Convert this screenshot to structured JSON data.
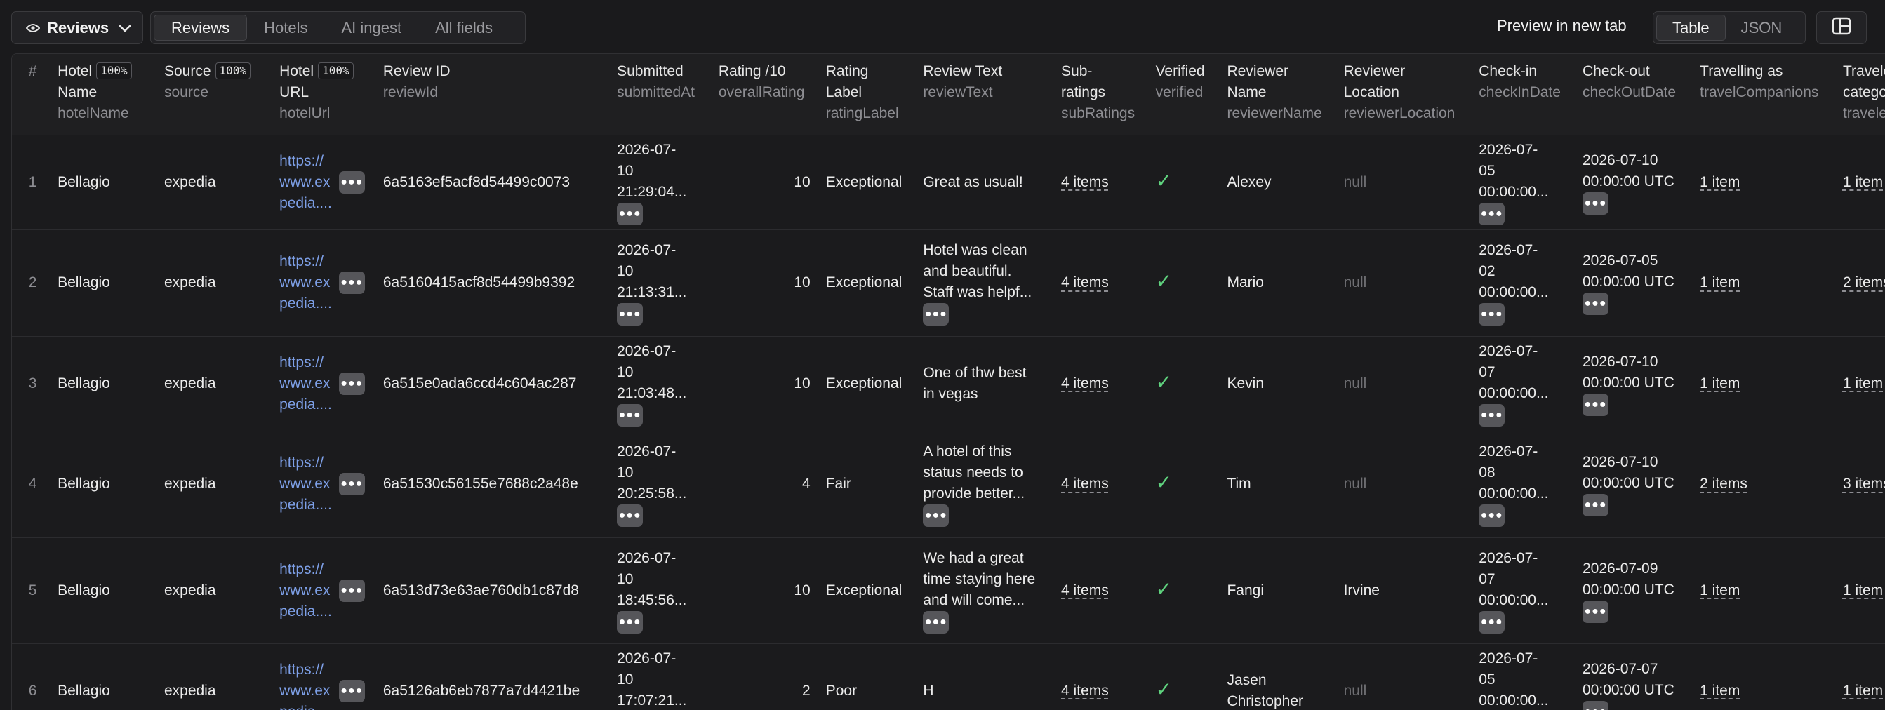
{
  "toolbar": {
    "view_label": "Reviews",
    "tabs": [
      {
        "label": "Reviews"
      },
      {
        "label": "Hotels"
      },
      {
        "label": "AI ingest"
      },
      {
        "label": "All fields"
      }
    ],
    "preview_label": "Preview in new tab",
    "format_tabs": [
      {
        "label": "Table"
      },
      {
        "label": "JSON"
      }
    ]
  },
  "columns": {
    "num": "#",
    "hotelName": {
      "title1": "Hotel",
      "title2": "Name",
      "pct": "100%",
      "key": "hotelName"
    },
    "source": {
      "title": "Source",
      "pct": "100%",
      "key": "source"
    },
    "hotelUrl": {
      "title1": "Hotel",
      "title2": "URL",
      "pct": "100%",
      "key": "hotelUrl"
    },
    "reviewId": {
      "title": "Review ID",
      "key": "reviewId"
    },
    "submittedAt": {
      "title": "Submitted",
      "key": "submittedAt"
    },
    "overallRating": {
      "title": "Rating /10",
      "key": "overallRating"
    },
    "ratingLabel": {
      "title1": "Rating",
      "title2": "Label",
      "key": "ratingLabel"
    },
    "reviewText": {
      "title": "Review Text",
      "key": "reviewText"
    },
    "subRatings": {
      "title1": "Sub-",
      "title2": "ratings",
      "key": "subRatings"
    },
    "verified": {
      "title": "Verified",
      "key": "verified"
    },
    "reviewerName": {
      "title1": "Reviewer",
      "title2": "Name",
      "key": "reviewerName"
    },
    "reviewerLocation": {
      "title1": "Reviewer",
      "title2": "Location",
      "key": "reviewerLocation"
    },
    "checkInDate": {
      "title": "Check-in",
      "key": "checkInDate"
    },
    "checkOutDate": {
      "title": "Check-out",
      "key": "checkOutDate"
    },
    "travelCompanions": {
      "title": "Travelling as",
      "key": "travelCompanions"
    },
    "travelerCategories": {
      "title1": "Traveler",
      "title2": "categories",
      "key": "travelerC"
    }
  },
  "rows": [
    {
      "num": "1",
      "hotel": "Bellagio",
      "source": "expedia",
      "url1": "https://",
      "url2": "www.ex",
      "url3": "pedia....",
      "reviewId": "6a5163ef5acf8d54499c0073",
      "sub1": "2026-07-",
      "sub2": "10",
      "sub3": "21:29:04...",
      "rating": "10",
      "label": "Exceptional",
      "text1": "Great as usual!",
      "text2": "",
      "text3": "",
      "subRatings": "4 items",
      "reviewer1": "Alexey",
      "reviewer2": "",
      "location": "null",
      "in1": "2026-07-",
      "in2": "05",
      "in3": "00:00:00...",
      "out1": "2026-07-10",
      "out2": "00:00:00 UTC",
      "companions": "1 item",
      "categories": "1 item"
    },
    {
      "num": "2",
      "hotel": "Bellagio",
      "source": "expedia",
      "url1": "https://",
      "url2": "www.ex",
      "url3": "pedia....",
      "reviewId": "6a5160415acf8d54499b9392",
      "sub1": "2026-07-",
      "sub2": "10",
      "sub3": "21:13:31...",
      "rating": "10",
      "label": "Exceptional",
      "text1": "Hotel was clean",
      "text2": "and beautiful.",
      "text3": "Staff was helpf...",
      "subRatings": "4 items",
      "reviewer1": "Mario",
      "reviewer2": "",
      "location": "null",
      "in1": "2026-07-",
      "in2": "02",
      "in3": "00:00:00...",
      "out1": "2026-07-05",
      "out2": "00:00:00 UTC",
      "companions": "1 item",
      "categories": "2 items"
    },
    {
      "num": "3",
      "hotel": "Bellagio",
      "source": "expedia",
      "url1": "https://",
      "url2": "www.ex",
      "url3": "pedia....",
      "reviewId": "6a515e0ada6ccd4c604ac287",
      "sub1": "2026-07-",
      "sub2": "10",
      "sub3": "21:03:48...",
      "rating": "10",
      "label": "Exceptional",
      "text1": "One of thw best",
      "text2": "in vegas",
      "text3": "",
      "subRatings": "4 items",
      "reviewer1": "Kevin",
      "reviewer2": "",
      "location": "null",
      "in1": "2026-07-",
      "in2": "07",
      "in3": "00:00:00...",
      "out1": "2026-07-10",
      "out2": "00:00:00 UTC",
      "companions": "1 item",
      "categories": "1 item"
    },
    {
      "num": "4",
      "hotel": "Bellagio",
      "source": "expedia",
      "url1": "https://",
      "url2": "www.ex",
      "url3": "pedia....",
      "reviewId": "6a51530c56155e7688c2a48e",
      "sub1": "2026-07-",
      "sub2": "10",
      "sub3": "20:25:58...",
      "rating": "4",
      "label": "Fair",
      "text1": "A hotel of this",
      "text2": "status needs to",
      "text3": "provide better...",
      "subRatings": "4 items",
      "reviewer1": "Tim",
      "reviewer2": "",
      "location": "null",
      "in1": "2026-07-",
      "in2": "08",
      "in3": "00:00:00...",
      "out1": "2026-07-10",
      "out2": "00:00:00 UTC",
      "companions": "2 items",
      "categories": "3 items"
    },
    {
      "num": "5",
      "hotel": "Bellagio",
      "source": "expedia",
      "url1": "https://",
      "url2": "www.ex",
      "url3": "pedia....",
      "reviewId": "6a513d73e63ae760db1c87d8",
      "sub1": "2026-07-",
      "sub2": "10",
      "sub3": "18:45:56...",
      "rating": "10",
      "label": "Exceptional",
      "text1": "We had a great",
      "text2": "time staying here",
      "text3": "and will come...",
      "subRatings": "4 items",
      "reviewer1": "Fangi",
      "reviewer2": "",
      "location": "Irvine",
      "in1": "2026-07-",
      "in2": "07",
      "in3": "00:00:00...",
      "out1": "2026-07-09",
      "out2": "00:00:00 UTC",
      "companions": "1 item",
      "categories": "1 item"
    },
    {
      "num": "6",
      "hotel": "Bellagio",
      "source": "expedia",
      "url1": "https://",
      "url2": "www.ex",
      "url3": "pedia....",
      "reviewId": "6a5126ab6eb7877a7d4421be",
      "sub1": "2026-07-",
      "sub2": "10",
      "sub3": "17:07:21...",
      "rating": "2",
      "label": "Poor",
      "text1": "H",
      "text2": "",
      "text3": "",
      "subRatings": "4 items",
      "reviewer1": "Jasen",
      "reviewer2": "Christopher",
      "location": "null",
      "in1": "2026-07-",
      "in2": "05",
      "in3": "00:00:00...",
      "out1": "2026-07-07",
      "out2": "00:00:00 UTC",
      "companions": "1 item",
      "categories": "1 item"
    }
  ],
  "colors": {
    "accent_link": "#7d9fe6",
    "verified": "#5fd27e",
    "background": "#1a1a1c"
  },
  "icons": {
    "view": "eye-icon",
    "dropdown": "chevron-down-icon",
    "layout": "layout-panels-icon",
    "more": "more-horizontal-icon",
    "verified": "check-icon"
  }
}
